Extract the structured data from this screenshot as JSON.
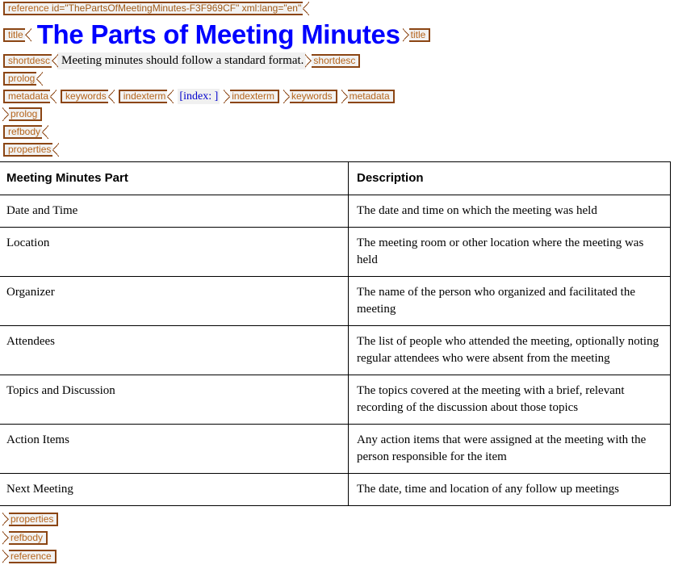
{
  "document": {
    "root_tag": {
      "name": "reference",
      "attributes": "id=\"ThePartsOfMeetingMinutes-F3F969CF\" xml:lang=\"en\""
    },
    "title": "The Parts of Meeting Minutes",
    "title_color": "#0000FF",
    "title_tag": "title",
    "shortdesc": {
      "tag": "shortdesc",
      "text": "Meeting minutes should follow a standard format."
    },
    "prolog_tag": "prolog",
    "metadata_tag": "metadata",
    "keywords_tag": "keywords",
    "indexterm_tag": "indexterm",
    "index_marker": "[index: ]",
    "refbody_tag": "refbody",
    "properties_tag": "properties"
  },
  "tag_colors": {
    "border": "#8B4513",
    "label": "#B5651D",
    "attribute": "#A15A17",
    "fill": "#F2F2F2"
  },
  "table": {
    "columns": [
      "Meeting Minutes Part",
      "Description"
    ],
    "rows": [
      {
        "part": "Date and Time",
        "description": "The date and time on which the meeting was held"
      },
      {
        "part": "Location",
        "description": "The meeting room or other location where the meeting was held"
      },
      {
        "part": "Organizer",
        "description": "The name of the person who organized and facilitated the meeting"
      },
      {
        "part": "Attendees",
        "description": "The list of people who attended the meeting, optionally noting regular attendees who were absent from the meeting"
      },
      {
        "part": "Topics and Discussion",
        "description": "The topics covered at the meeting with a brief, relevant recording of the discussion about those topics"
      },
      {
        "part": "Action Items",
        "description": "Any action items that were assigned at the meeting with the person responsible for the item"
      },
      {
        "part": "Next Meeting",
        "description": "The date, time and location of any follow up meetings"
      }
    ]
  }
}
